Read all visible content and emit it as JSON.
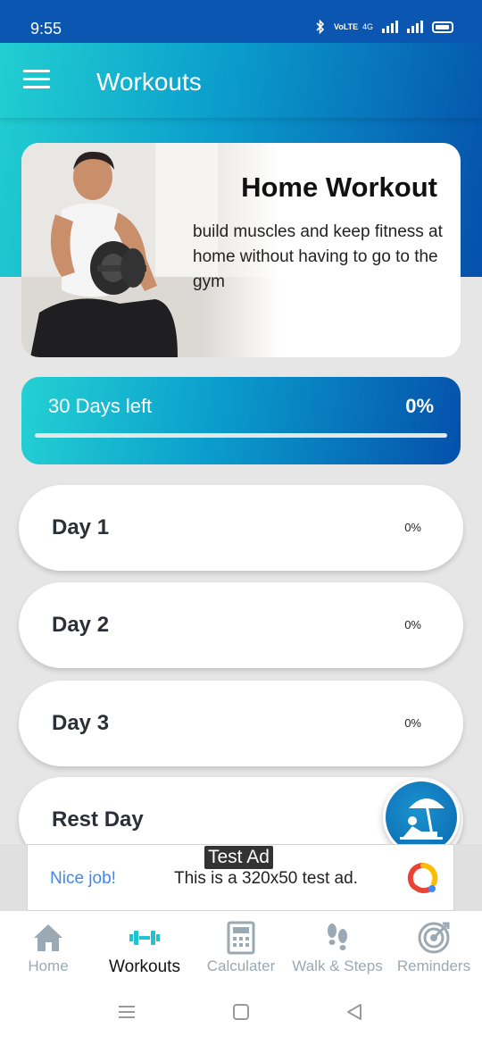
{
  "status_bar": {
    "time": "9:55",
    "network_label": "VoLTE",
    "network_type": "4G"
  },
  "app_bar": {
    "title": "Workouts"
  },
  "hero": {
    "title": "Home Workout",
    "description": "build muscles and keep fitness at home without having to go to the gym"
  },
  "progress": {
    "label": "30 Days left",
    "percent_label": "0%",
    "value": 0
  },
  "days": [
    {
      "label": "Day 1",
      "percent": "0%"
    },
    {
      "label": "Day 2",
      "percent": "0%"
    },
    {
      "label": "Day 3",
      "percent": "0%"
    },
    {
      "label": "Rest Day",
      "percent": ""
    }
  ],
  "ad": {
    "tag": "Test Ad",
    "headline": "Nice job!",
    "body": "This is a 320x50 test ad."
  },
  "bottom_nav": [
    {
      "label": "Home",
      "icon": "home-icon"
    },
    {
      "label": "Workouts",
      "icon": "dumbbell-icon",
      "active": true
    },
    {
      "label": "Calculater",
      "icon": "calculator-icon"
    },
    {
      "label": "Walk & Steps",
      "icon": "footsteps-icon"
    },
    {
      "label": "Reminders",
      "icon": "target-icon"
    }
  ],
  "colors": {
    "accent_start": "#22cfd1",
    "accent_end": "#0550ab",
    "nav_inactive": "#9aa9b3",
    "ad_blue": "#4285f4"
  }
}
